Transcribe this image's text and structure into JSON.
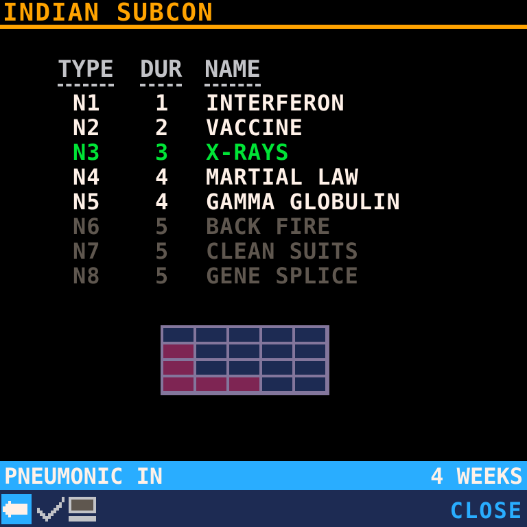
{
  "title": "INDIAN SUBCON",
  "columns": {
    "type": "TYPE",
    "dur": "DUR",
    "name": "NAME"
  },
  "rows": [
    {
      "type": "n1",
      "dur": "1",
      "name": "INTERFERON",
      "state": "available"
    },
    {
      "type": "n2",
      "dur": "2",
      "name": "VACCINE",
      "state": "available"
    },
    {
      "type": "n3",
      "dur": "3",
      "name": "X-RAYS",
      "state": "selected"
    },
    {
      "type": "n4",
      "dur": "4",
      "name": "MARTIAL LAW",
      "state": "available"
    },
    {
      "type": "n5",
      "dur": "4",
      "name": "GAMMA GLOBULIN",
      "state": "available"
    },
    {
      "type": "n6",
      "dur": "5",
      "name": "BACK FIRE",
      "state": "locked"
    },
    {
      "type": "n7",
      "dur": "5",
      "name": "CLEAN SUITS",
      "state": "locked"
    },
    {
      "type": "n8",
      "dur": "5",
      "name": "GENE SPLICE",
      "state": "locked"
    }
  ],
  "progress_grid": {
    "cols": 5,
    "rows": 4,
    "fill_per_row": [
      0,
      1,
      1,
      3
    ]
  },
  "footer": {
    "label": "PNEUMONIC IN",
    "weeks": "4 WEEKS"
  },
  "toolbar": {
    "icons": [
      "back-arrow-icon",
      "checkmark-icon",
      "monitor-icon"
    ],
    "close_label": "CLOSE"
  },
  "colors": {
    "accent": "#ffa300",
    "available": "#fff1e8",
    "selected": "#00e436",
    "locked": "#5f574f",
    "footer_bar": "#29adff",
    "toolbar_bg": "#1d2b53",
    "grid_fill": "#7e2553"
  }
}
